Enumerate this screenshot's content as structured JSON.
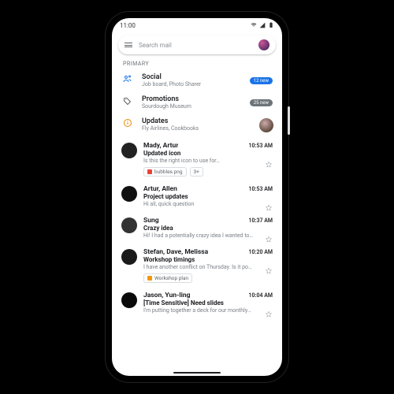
{
  "status": {
    "time": "11:00"
  },
  "search": {
    "placeholder": "Search mail"
  },
  "section": "PRIMARY",
  "categories": [
    {
      "title": "Social",
      "sub": "Job board, Photo Sharer",
      "badge": "12 new",
      "badgeClass": "badge-blue",
      "icon": "people"
    },
    {
      "title": "Promotions",
      "sub": "Sourdough Museum",
      "badge": "25 new",
      "badgeClass": "badge-grey",
      "icon": "tag"
    },
    {
      "title": "Updates",
      "sub": "Fly Airlines, Cookbooks",
      "icon": "info",
      "floatAvatar": true
    }
  ],
  "mails": [
    {
      "sender": "Mady, Artur",
      "time": "10:53 AM",
      "subject": "Updated icon",
      "snippet": "Is this the right icon to use for…",
      "avatar": "#222",
      "chips": [
        {
          "label": "bubbles.png",
          "color": "sq-red"
        },
        {
          "label": "3+",
          "plain": true
        }
      ]
    },
    {
      "sender": "Artur, Allen",
      "time": "10:53 AM",
      "subject": "Project updates",
      "snippet": "Hi all, quick question",
      "avatar": "#111"
    },
    {
      "sender": "Sung",
      "time": "10:37 AM",
      "subject": "Crazy idea",
      "snippet": "Hi! I had a potentially crazy idea I wanted to…",
      "avatar": "#333"
    },
    {
      "sender": "Stefan, Dave, Melissa",
      "time": "10:20 AM",
      "subject": "Workshop timings",
      "snippet": "I have another conflict on Thursday. Is it po…",
      "avatar": "#1a1a1a",
      "chips": [
        {
          "label": "Workshop plan",
          "color": "sq-orange"
        }
      ]
    },
    {
      "sender": "Jason, Yun-ling",
      "time": "10:04 AM",
      "subject": "[Time Sensitive] Need slides",
      "snippet": "I'm putting together a deck for our monthly…",
      "avatar": "#0a0a0a"
    }
  ]
}
